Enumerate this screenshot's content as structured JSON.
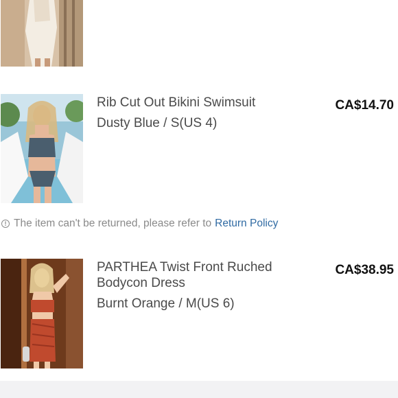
{
  "items": [
    {
      "image_name": "white-crochet-dress-photo",
      "name": "",
      "variant": "",
      "price": ""
    },
    {
      "image_name": "bikini-swimsuit-photo",
      "name": "Rib Cut Out Bikini Swimsuit",
      "variant": "Dusty Blue / S(US 4)",
      "price": "CA$14.70"
    },
    {
      "image_name": "bodycon-dress-photo",
      "name_line1": "PARTHEA Twist Front Ruched",
      "name_line2": "Bodycon Dress",
      "variant": "Burnt Orange / M(US 6)",
      "price": "CA$38.95"
    }
  ],
  "notice": {
    "icon": "info-icon",
    "text": "The item can't be returned, please refer to",
    "link": "Return Policy"
  },
  "colors": {
    "price": "#111111",
    "text": "#4a4a4a",
    "muted": "#8a8a8a",
    "link": "#2f6aa3"
  }
}
